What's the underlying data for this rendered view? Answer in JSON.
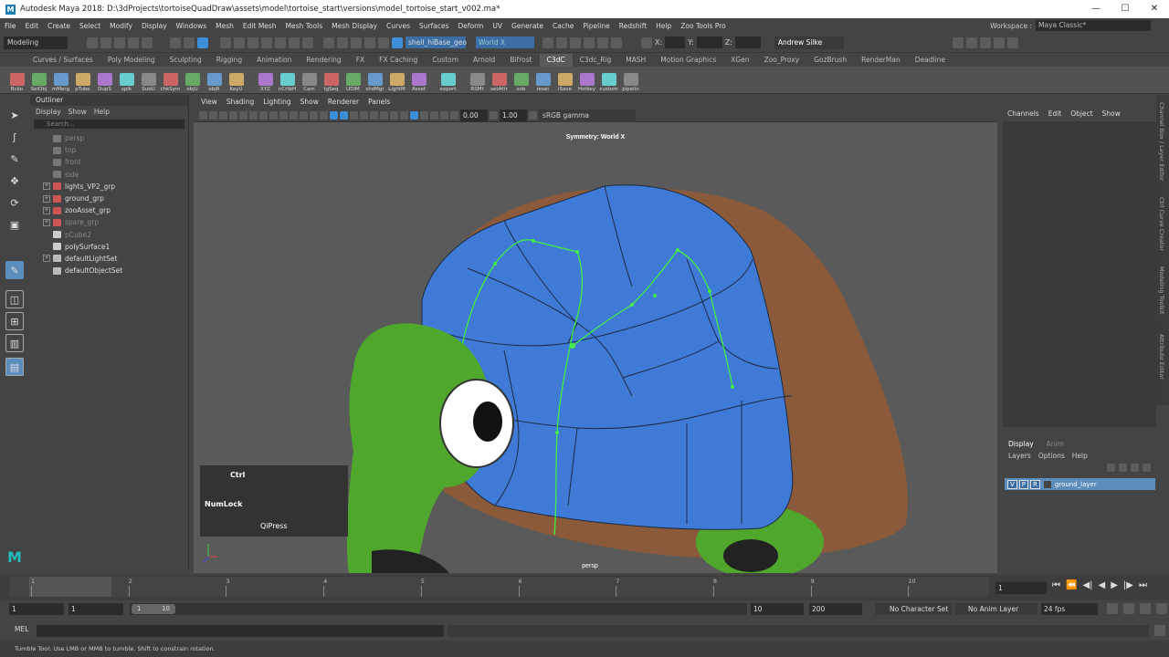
{
  "window": {
    "app_title": "Autodesk Maya 2018: D:\\3dProjects\\tortoiseQuadDraw\\assets\\model\\tortoise_start\\versions\\model_tortoise_start_v002.ma*",
    "minimize": "—",
    "maximize": "☐",
    "close": "✕"
  },
  "menubar": {
    "items": [
      "File",
      "Edit",
      "Create",
      "Select",
      "Modify",
      "Display",
      "Windows",
      "Mesh",
      "Edit Mesh",
      "Mesh Tools",
      "Mesh Display",
      "Curves",
      "Surfaces",
      "Deform",
      "UV",
      "Generate",
      "Cache",
      "Pipeline",
      "Redshift",
      "Help",
      "Zoo Tools Pro"
    ],
    "workspace_label": "Workspace :",
    "workspace_value": "Maya Classic*"
  },
  "statusline": {
    "mode": "Modeling",
    "object_name": "shell_hiBase_geo",
    "symmetry": "World X",
    "x_label": "X:",
    "y_label": "Y:",
    "z_label": "Z:",
    "user": "Andrew Silke"
  },
  "shelf_tabs": [
    "Curves / Surfaces",
    "Poly Modeling",
    "Sculpting",
    "Rigging",
    "Animation",
    "Rendering",
    "FX",
    "FX Caching",
    "Custom",
    "Arnold",
    "Bifrost",
    "C3dC",
    "C3dc_Rig",
    "MASH",
    "Motion Graphics",
    "XGen",
    "Zoo_Proxy",
    "GozBrush",
    "RenderMan",
    "Deadline"
  ],
  "shelf_active": "C3dC",
  "shelf_buttons": [
    "Bcko",
    "SelObj",
    "mMerg",
    "pTube",
    "DupS",
    "spik",
    "SubU",
    "chkSym",
    "objU",
    "objR",
    "KeyU",
    "XYZ",
    "nCrtbH",
    "Cam",
    "tgSeq",
    "UDIM",
    "shdMgr",
    "LightM",
    "Asset",
    "export",
    "RSMt",
    "setAttr",
    "sob",
    "reset",
    "iSave",
    "Hotkey",
    "custom",
    "pipelin"
  ],
  "outliner": {
    "title": "Outliner",
    "menu": [
      "Display",
      "Show",
      "Help"
    ],
    "search_placeholder": "Search...",
    "items": [
      {
        "name": "persp",
        "dim": true,
        "expand": false,
        "kind": "cam"
      },
      {
        "name": "top",
        "dim": true,
        "expand": false,
        "kind": "cam"
      },
      {
        "name": "front",
        "dim": true,
        "expand": false,
        "kind": "cam"
      },
      {
        "name": "side",
        "dim": true,
        "expand": false,
        "kind": "cam"
      },
      {
        "name": "lights_VP2_grp",
        "dim": false,
        "expand": true,
        "kind": "grp"
      },
      {
        "name": "ground_grp",
        "dim": false,
        "expand": true,
        "kind": "grp"
      },
      {
        "name": "zooAsset_grp",
        "dim": false,
        "expand": true,
        "kind": "grp"
      },
      {
        "name": "spare_grp",
        "dim": true,
        "expand": true,
        "kind": "grp"
      },
      {
        "name": "pCube2",
        "dim": true,
        "expand": false,
        "kind": "mesh"
      },
      {
        "name": "polySurface1",
        "dim": false,
        "expand": false,
        "kind": "mesh"
      },
      {
        "name": "defaultLightSet",
        "dim": false,
        "expand": true,
        "kind": "set"
      },
      {
        "name": "defaultObjectSet",
        "dim": false,
        "expand": false,
        "kind": "set"
      }
    ]
  },
  "viewport": {
    "menu": [
      "View",
      "Shading",
      "Lighting",
      "Show",
      "Renderer",
      "Panels"
    ],
    "exposure": "0.00",
    "gamma": "1.00",
    "color_space": "sRGB gamma",
    "hud_symmetry": "Symmetry: World X",
    "camera": "persp"
  },
  "keys_overlay": {
    "line1": "Ctrl",
    "line2": "NumLock",
    "line3": "QiPress"
  },
  "channel_box": {
    "menu": [
      "Channels",
      "Edit",
      "Object",
      "Show"
    ],
    "layer_tabs": [
      "Display",
      "Anim"
    ],
    "layer_menu": [
      "Layers",
      "Options",
      "Help"
    ],
    "layer": {
      "v": "V",
      "p": "P",
      "r": "R",
      "name": "ground_layer"
    }
  },
  "side_tabs": [
    "Channel Box / Layer Editor",
    "Ctrl Curve Creator",
    "Modeling Toolkit",
    "Attribute Editor"
  ],
  "timeline": {
    "ticks": [
      "1",
      "2",
      "3",
      "4",
      "5",
      "6",
      "7",
      "8",
      "9",
      "10"
    ],
    "current": "1"
  },
  "range": {
    "start": "1",
    "start2": "1",
    "slider_start": "1",
    "slider_end": "10",
    "end": "10",
    "end2": "200",
    "character": "No Character Set",
    "anim_layer": "No Anim Layer",
    "fps": "24 fps"
  },
  "command": {
    "label": "MEL"
  },
  "help_line": "Tumble Tool: Use LMB or MMB to tumble. Shift to constrain rotation.",
  "colors": {
    "accent": "#5b8dbd",
    "shell_blue": "#3f7bd6",
    "turtle_green": "#4fa82c",
    "quad_draw": "#44ee44"
  }
}
